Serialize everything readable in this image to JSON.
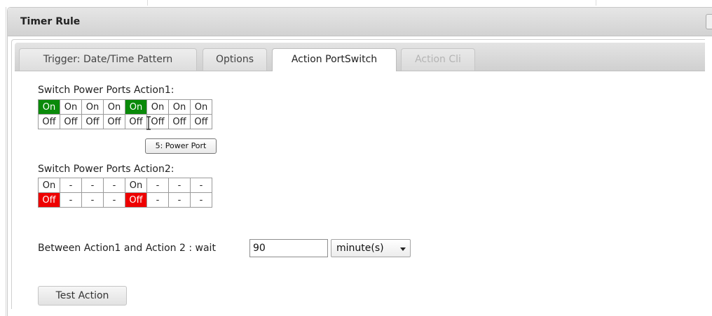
{
  "dialog": {
    "title": "Timer Rule"
  },
  "tabs": [
    {
      "label": "Trigger: Date/Time Pattern",
      "state": "normal"
    },
    {
      "label": "Options",
      "state": "normal"
    },
    {
      "label": "Action PortSwitch",
      "state": "active"
    },
    {
      "label": "Action Cli",
      "state": "disabled"
    }
  ],
  "action1": {
    "label": "Switch Power Ports Action1:",
    "on_row": [
      "On",
      "On",
      "On",
      "On",
      "On",
      "On",
      "On",
      "On"
    ],
    "off_row": [
      "Off",
      "Off",
      "Off",
      "Off",
      "Off",
      "Off",
      "Off",
      "Off"
    ],
    "selected_on_ports": [
      1,
      5
    ]
  },
  "tooltip": {
    "text": "5: Power Port"
  },
  "action2": {
    "label": "Switch Power Ports Action2:",
    "on_row": [
      "On",
      "-",
      "-",
      "-",
      "On",
      "-",
      "-",
      "-"
    ],
    "off_row": [
      "Off",
      "-",
      "-",
      "-",
      "Off",
      "-",
      "-",
      "-"
    ],
    "selected_off_ports": [
      1,
      5
    ]
  },
  "wait": {
    "label": "Between Action1 and Action 2 : wait",
    "value": "90",
    "unit": "minute(s)"
  },
  "buttons": {
    "test_action": "Test Action"
  },
  "colors": {
    "on_selected": "#0a8a0a",
    "off_selected": "#ee0000"
  }
}
